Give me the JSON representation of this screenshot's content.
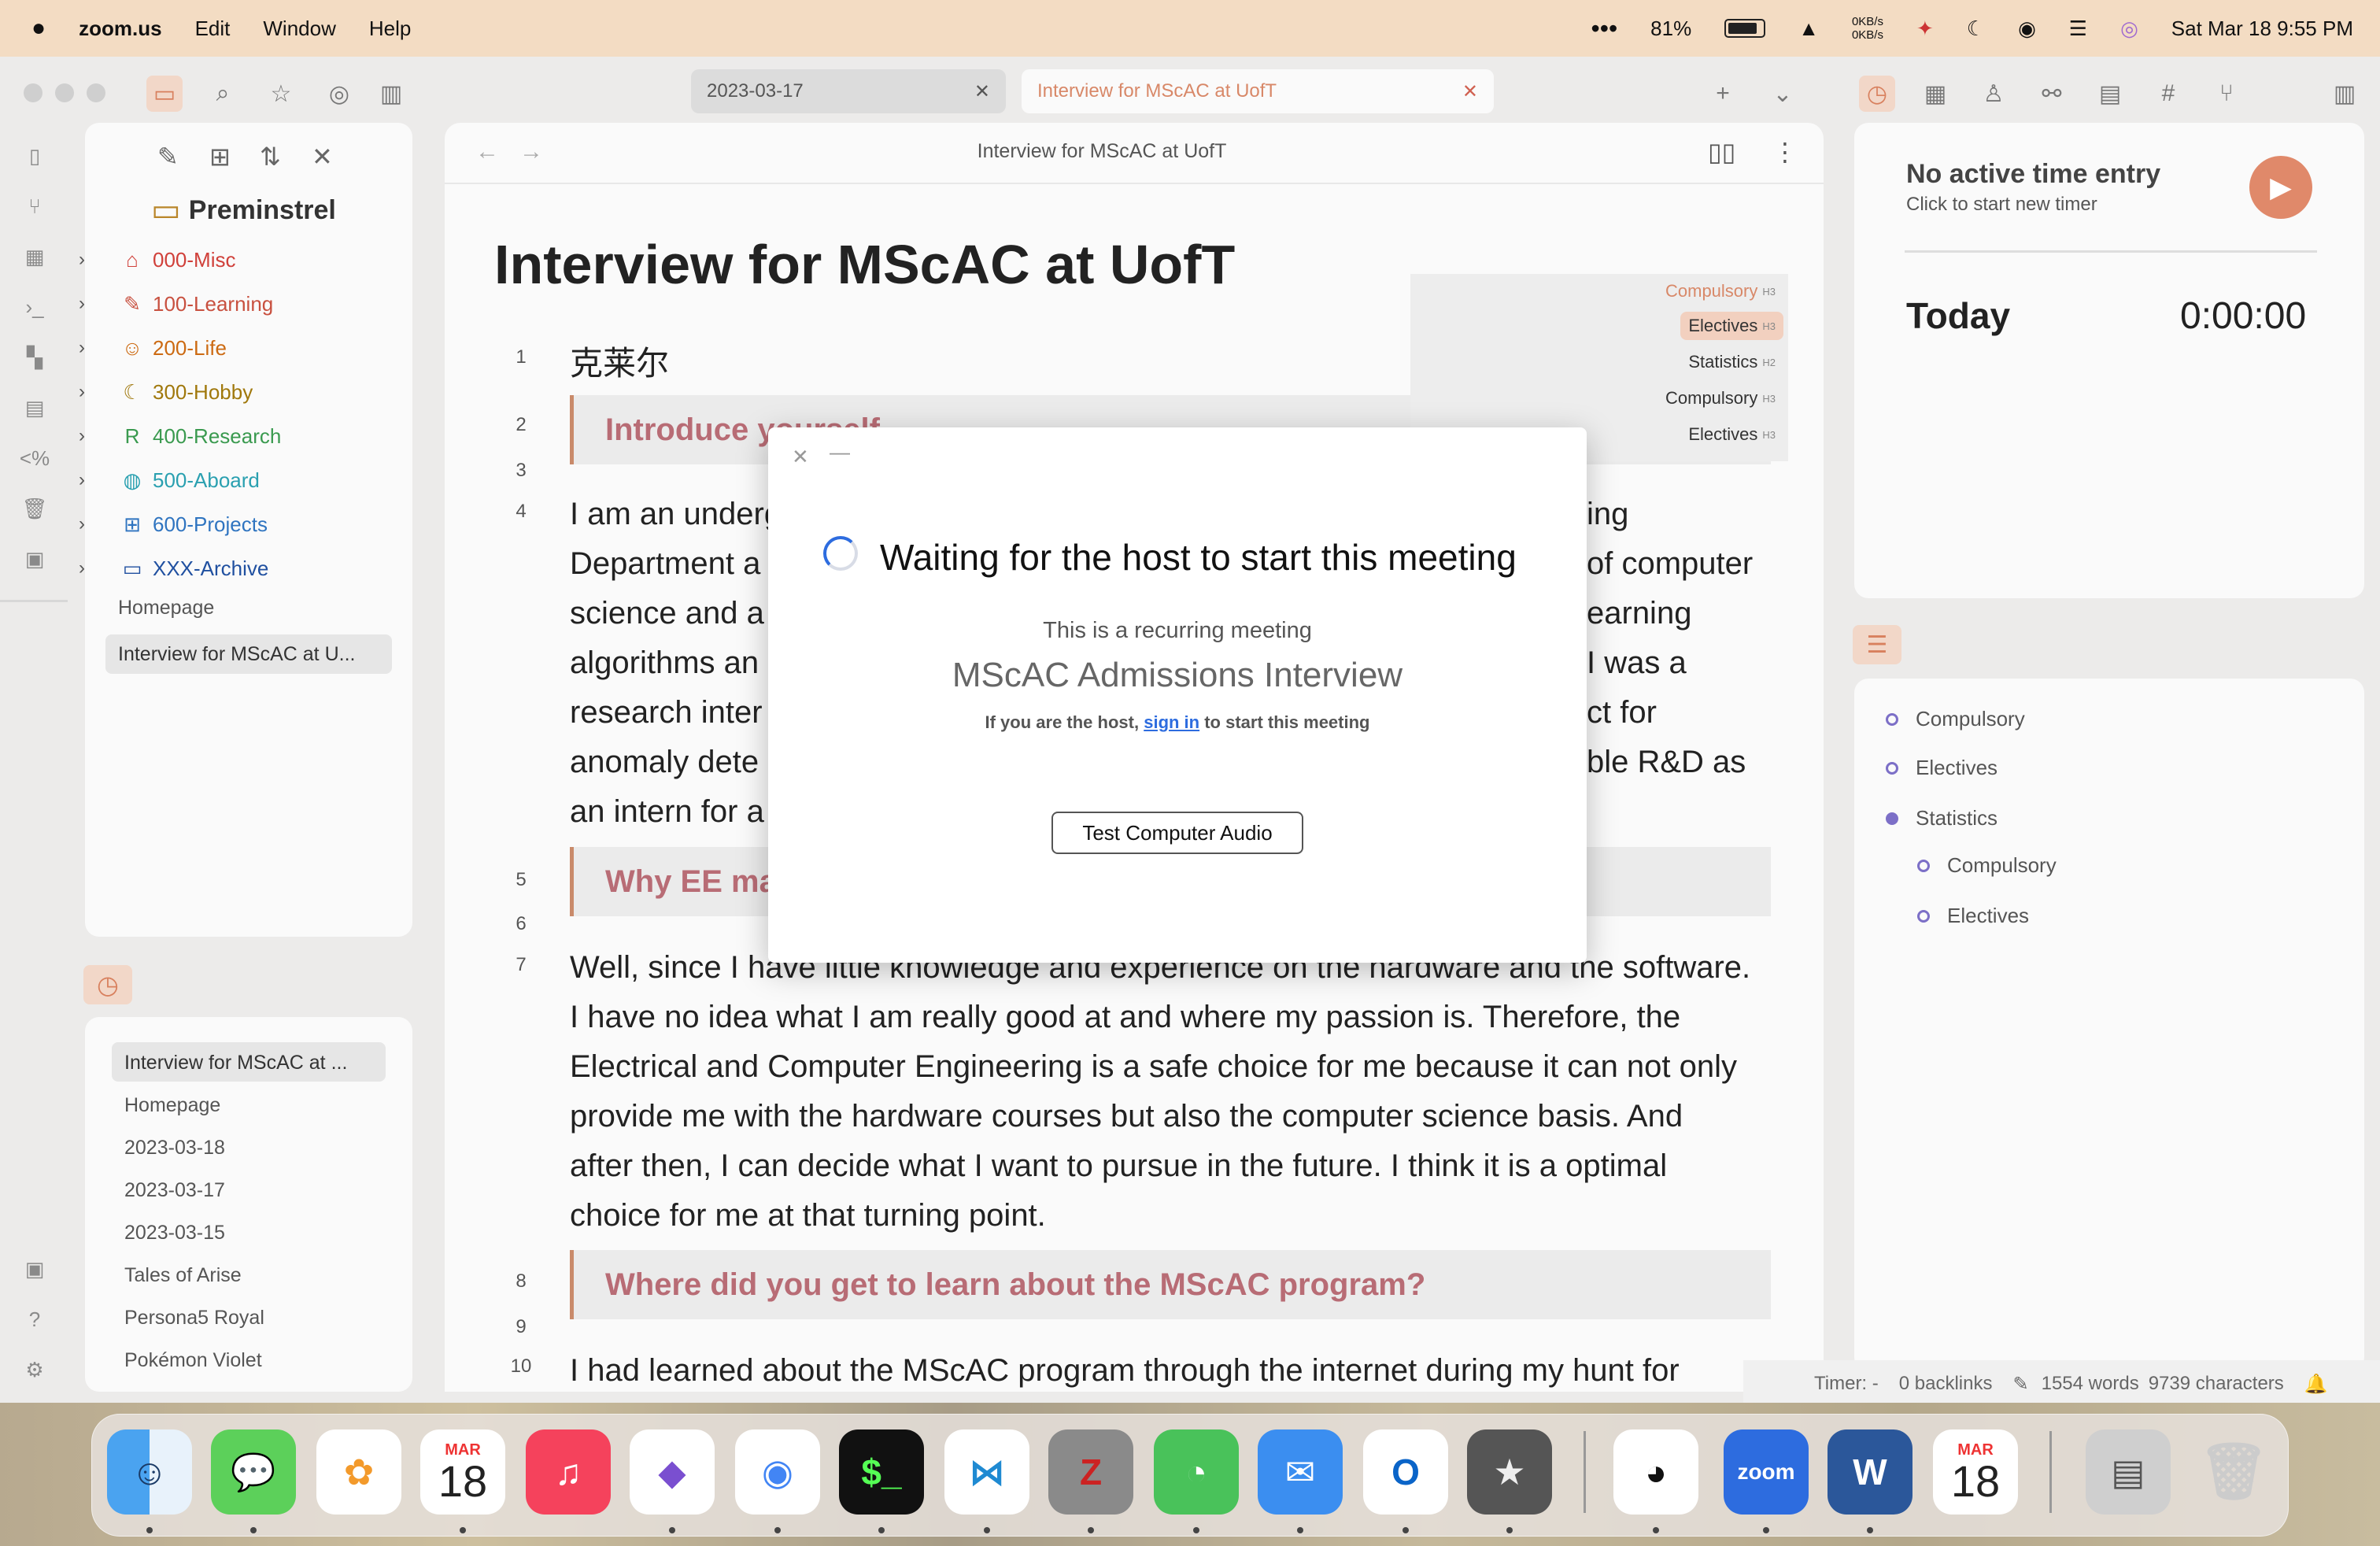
{
  "menubar": {
    "app_name": "zoom.us",
    "items": [
      "Edit",
      "Window",
      "Help"
    ],
    "battery": "81%",
    "net_up": "0KB/s",
    "net_down": "0KB/s",
    "datetime": "Sat Mar 18  9:55 PM"
  },
  "tabs": [
    {
      "label": "2023-03-17"
    },
    {
      "label": "Interview for MScAC at UofT"
    }
  ],
  "sidebar": {
    "vault_name": "Preminstrel",
    "folders": [
      {
        "label": "000-Misc",
        "color": "#d0403a",
        "icon": "house-icon"
      },
      {
        "label": "100-Learning",
        "color": "#c8503f",
        "icon": "pencil-icon"
      },
      {
        "label": "200-Life",
        "color": "#cc6a12",
        "icon": "smile-icon"
      },
      {
        "label": "300-Hobby",
        "color": "#a0780c",
        "icon": "moon-icon"
      },
      {
        "label": "400-Research",
        "color": "#3a9a4f",
        "icon": "research-icon"
      },
      {
        "label": "500-Aboard",
        "color": "#2aa0b0",
        "icon": "globe-icon"
      },
      {
        "label": "600-Projects",
        "color": "#2f74c0",
        "icon": "hierarchy-icon"
      },
      {
        "label": "XXX-Archive",
        "color": "#2050a0",
        "icon": "archive-icon"
      }
    ],
    "files": [
      "Homepage",
      "Interview for MScAC at U..."
    ]
  },
  "recent": {
    "items": [
      "Interview for MScAC at ...",
      "Homepage",
      "2023-03-18",
      "2023-03-17",
      "2023-03-15",
      "Tales of Arise",
      "Persona5 Royal",
      "Pokémon Violet"
    ]
  },
  "editor": {
    "header_title": "Interview for MScAC at UofT",
    "doc_title": "Interview for MScAC at UofT",
    "line1": "克莱尔",
    "heading1": "Introduce yourself",
    "para4": [
      "I am an underg",
      "Department a",
      "science and a",
      "algorithms an",
      "research inter",
      "anomaly dete",
      "an intern for a"
    ],
    "para4_right": [
      "ing",
      "of computer",
      "earning",
      "I was a",
      "ct for",
      "ble R&D as",
      ""
    ],
    "heading2": "Why EE ma",
    "para7": [
      "Well, since I have little knowledge and experience on the hardware and the software.",
      "I have no idea what I am really good at and where my passion is. Therefore, the",
      "Electrical and Computer Engineering is a safe choice for me because it can not only",
      "provide me with the hardware courses but also the computer science basis. And",
      "after then, I can decide what I want to pursue in the future. I think it is a optimal",
      "choice for me at that turning point."
    ],
    "heading3": "Where did you get to learn about the MScAC program?",
    "line10": "I had learned about the MScAC program through the internet during my hunt for",
    "line_numbers": [
      "1",
      "2",
      "3",
      "4",
      "5",
      "6",
      "7",
      "8",
      "9",
      "10"
    ]
  },
  "mini_outline": [
    {
      "label": "Compulsory",
      "level": "H3"
    },
    {
      "label": "Electives",
      "level": "H3"
    },
    {
      "label": "Statistics",
      "level": "H2"
    },
    {
      "label": "Compulsory",
      "level": "H3"
    },
    {
      "label": "Electives",
      "level": "H3"
    }
  ],
  "modal": {
    "status": "Waiting for the host to start this meeting",
    "recurring": "This is a recurring meeting",
    "meeting_name": "MScAC Admissions Interview",
    "host_prefix": "If you are the host,",
    "host_link": "sign in",
    "host_suffix": "to start this meeting",
    "test_audio": "Test Computer Audio"
  },
  "timer": {
    "title": "No active time entry",
    "subtitle": "Click to start new timer",
    "today_label": "Today",
    "today_value": "0:00:00"
  },
  "outline": [
    "Compulsory",
    "Electives",
    "Statistics",
    "Compulsory",
    "Electives"
  ],
  "status": {
    "timer": "Timer: -",
    "backlinks": "0 backlinks",
    "words": "1554 words",
    "chars": "9739 characters"
  },
  "dock": {
    "calendar_month": "MAR",
    "calendar_day": "18",
    "zoom_label": "zoom"
  },
  "colors": {
    "accent": "#e0896a",
    "heading": "#b86c75",
    "menubar": "#f3dcc3"
  }
}
